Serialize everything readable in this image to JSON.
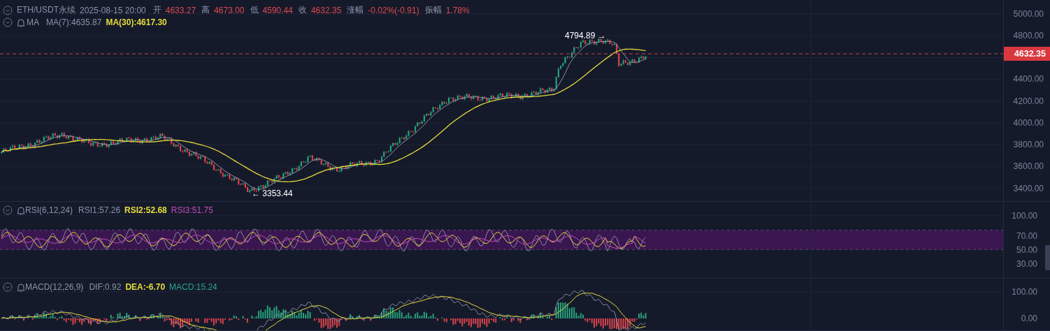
{
  "header": {
    "symbol": "ETH/USDT永续",
    "datetime": "2025-08-15 20:00",
    "fields": [
      {
        "label": "开",
        "value": "4633.27"
      },
      {
        "label": "高",
        "value": "4673.00"
      },
      {
        "label": "低",
        "value": "4590.44"
      },
      {
        "label": "收",
        "value": "4632.35"
      },
      {
        "label": "涨幅",
        "value": "-0.02%(-0.91)"
      },
      {
        "label": "振幅",
        "value": "1.78%"
      }
    ]
  },
  "ma": {
    "title": "MA",
    "values": [
      {
        "text": "MA(7):4635.87",
        "color": "#8c93a8"
      },
      {
        "text": "MA(30):4617.30",
        "color": "#e6dc3a"
      }
    ]
  },
  "price_axis": {
    "ticks": [
      "5000.00",
      "4800.00",
      "4400.00",
      "4200.00",
      "4000.00",
      "3800.00",
      "3600.00",
      "3400.00"
    ],
    "current_price": "4632.35"
  },
  "annotations": {
    "high": "4794.89 →",
    "low": "← 3353.44"
  },
  "rsi": {
    "title": "RSI(6,12,24)",
    "values": [
      {
        "text": "RSI1:57.26",
        "color": "#8c93a8"
      },
      {
        "text": "RSI2:52.68",
        "color": "#e6dc3a"
      },
      {
        "text": "RSI3:51.75",
        "color": "#c04bb8"
      }
    ],
    "ticks": [
      "100.00",
      "70.00",
      "50.00",
      "30.00"
    ]
  },
  "macd": {
    "title": "MACD(12,26,9)",
    "values": [
      {
        "text": "DIF:0.92",
        "color": "#8c93a8"
      },
      {
        "text": "DEA:-6.70",
        "color": "#e6dc3a"
      },
      {
        "text": "MACD:15.24",
        "color": "#2aa58a"
      }
    ],
    "ticks": [
      "100.00",
      "0.00"
    ]
  }
}
